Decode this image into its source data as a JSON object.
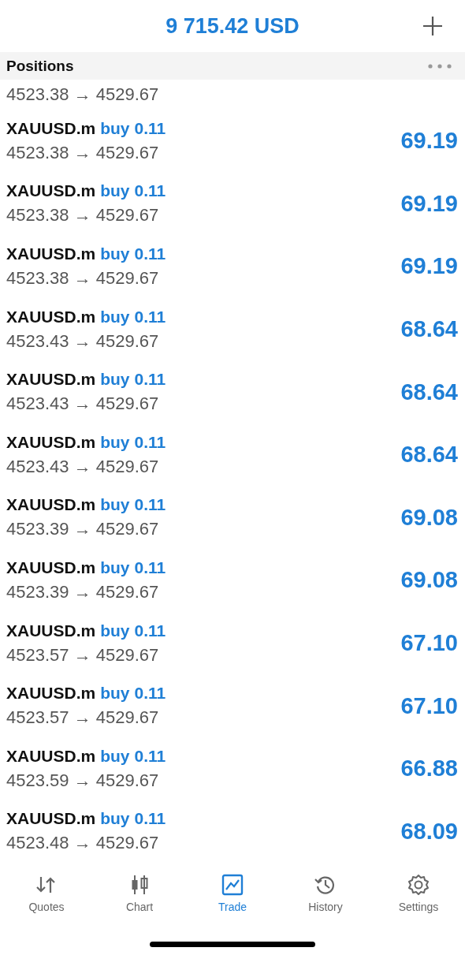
{
  "header": {
    "balance": "9 715.42 USD"
  },
  "section": {
    "title": "Positions"
  },
  "partial_row": {
    "prices": "4523.38 → 4529.67"
  },
  "positions": [
    {
      "symbol": "XAUUSD.m",
      "side": "buy",
      "volume": "0.11",
      "prices": "4523.38 → 4529.67",
      "profit": "69.19"
    },
    {
      "symbol": "XAUUSD.m",
      "side": "buy",
      "volume": "0.11",
      "prices": "4523.38 → 4529.67",
      "profit": "69.19"
    },
    {
      "symbol": "XAUUSD.m",
      "side": "buy",
      "volume": "0.11",
      "prices": "4523.38 → 4529.67",
      "profit": "69.19"
    },
    {
      "symbol": "XAUUSD.m",
      "side": "buy",
      "volume": "0.11",
      "prices": "4523.43 → 4529.67",
      "profit": "68.64"
    },
    {
      "symbol": "XAUUSD.m",
      "side": "buy",
      "volume": "0.11",
      "prices": "4523.43 → 4529.67",
      "profit": "68.64"
    },
    {
      "symbol": "XAUUSD.m",
      "side": "buy",
      "volume": "0.11",
      "prices": "4523.43 → 4529.67",
      "profit": "68.64"
    },
    {
      "symbol": "XAUUSD.m",
      "side": "buy",
      "volume": "0.11",
      "prices": "4523.39 → 4529.67",
      "profit": "69.08"
    },
    {
      "symbol": "XAUUSD.m",
      "side": "buy",
      "volume": "0.11",
      "prices": "4523.39 → 4529.67",
      "profit": "69.08"
    },
    {
      "symbol": "XAUUSD.m",
      "side": "buy",
      "volume": "0.11",
      "prices": "4523.57 → 4529.67",
      "profit": "67.10"
    },
    {
      "symbol": "XAUUSD.m",
      "side": "buy",
      "volume": "0.11",
      "prices": "4523.57 → 4529.67",
      "profit": "67.10"
    },
    {
      "symbol": "XAUUSD.m",
      "side": "buy",
      "volume": "0.11",
      "prices": "4523.59 → 4529.67",
      "profit": "66.88"
    },
    {
      "symbol": "XAUUSD.m",
      "side": "buy",
      "volume": "0.11",
      "prices": "4523.48 → 4529.67",
      "profit": "68.09"
    }
  ],
  "tabs": [
    {
      "label": "Quotes",
      "kind": "quotes",
      "selected": false
    },
    {
      "label": "Chart",
      "kind": "chart",
      "selected": false
    },
    {
      "label": "Trade",
      "kind": "trade",
      "selected": true
    },
    {
      "label": "History",
      "kind": "history",
      "selected": false
    },
    {
      "label": "Settings",
      "kind": "settings",
      "selected": false
    }
  ]
}
